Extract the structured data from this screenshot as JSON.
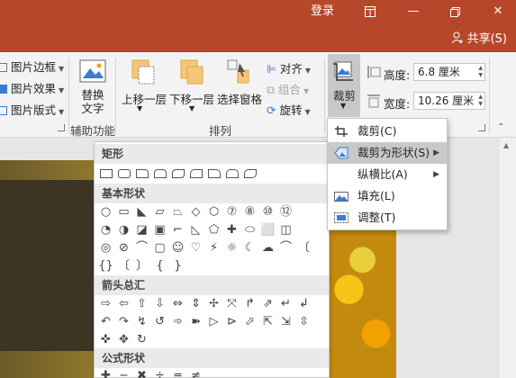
{
  "titlebar": {
    "login": "登录",
    "share": "共享(S)"
  },
  "ribbon": {
    "left_group": {
      "items": [
        "图片边框",
        "图片效果",
        "图片版式"
      ]
    },
    "aux": {
      "replace_text_line1": "替换",
      "replace_text_line2": "文字",
      "label": "辅助功能"
    },
    "arrange": {
      "bring_forward": "上移一层",
      "send_backward": "下移一层",
      "selection_pane": "选择窗格",
      "align": "对齐",
      "group": "组合",
      "rotate": "旋转",
      "label": "排列"
    },
    "size": {
      "crop": "裁剪",
      "height_label": "高度:",
      "height_value": "6.8 厘米",
      "width_label": "宽度:",
      "width_value": "10.26 厘米"
    }
  },
  "gallery": {
    "sections": [
      "矩形",
      "基本形状",
      "箭头总汇",
      "公式形状"
    ],
    "basic_rows": [
      [
        "○",
        "▭",
        "◣",
        "▱",
        "⏢",
        "◇",
        "⬡",
        "⑦",
        "⑧",
        "⑩",
        "⑫"
      ],
      [
        "◔",
        "◑",
        "◪",
        "▣",
        "⌐",
        "◺",
        "⬠",
        "✚",
        "⬭",
        "⬜",
        "◫"
      ],
      [
        "◎",
        "⊘",
        "⌒",
        "▢",
        "☺",
        "♡",
        "⚡",
        "☼",
        "☾",
        "☁",
        "⌒",
        "〔"
      ],
      [
        "{}",
        "〔",
        "〕",
        "{",
        "}"
      ]
    ],
    "arrow_rows": [
      [
        "⇨",
        "⇦",
        "⇧",
        "⇩",
        "⇔",
        "⇕",
        "✢",
        "⤧",
        "↱",
        "⇗",
        "↵",
        "↲"
      ],
      [
        "↶",
        "↷",
        "↯",
        "↺",
        "➾",
        "➽",
        "▷",
        "⊳",
        "⬀",
        "⇱",
        "⇲",
        "⇳"
      ],
      [
        "✜",
        "✥",
        "↻"
      ]
    ],
    "formula_row": [
      "✚",
      "−",
      "✖",
      "÷",
      "═",
      "≠"
    ]
  },
  "crop_menu": {
    "items": [
      {
        "label": "裁剪(C)",
        "icon": "crop-icon"
      },
      {
        "label": "裁剪为形状(S)",
        "icon": "shape-crop-icon",
        "submenu": true
      },
      {
        "label": "纵横比(A)",
        "icon": "",
        "submenu": true
      },
      {
        "label": "填充(L)",
        "icon": "fill-icon"
      },
      {
        "label": "调整(T)",
        "icon": "fit-icon"
      }
    ]
  },
  "colors": {
    "titlebar": "#b7472a",
    "ribbon": "#f3f3f3",
    "menu_highlight": "#c8c8c8"
  }
}
